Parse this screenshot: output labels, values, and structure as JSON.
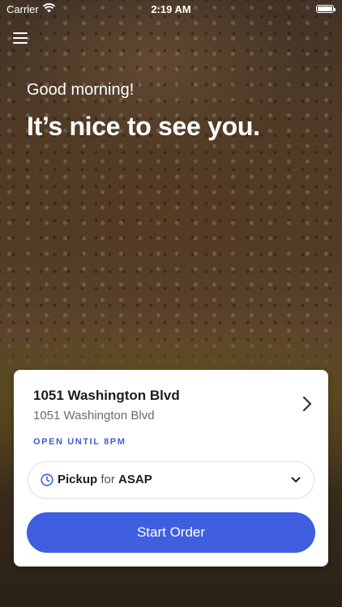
{
  "status_bar": {
    "carrier": "Carrier",
    "time": "2:19 AM",
    "wifi_icon": "wifi-icon",
    "battery_icon": "battery-icon"
  },
  "header": {
    "menu_icon": "hamburger-menu-icon",
    "greeting": "Good morning!",
    "headline": "It’s nice to see you."
  },
  "location_card": {
    "name": "1051 Washington Blvd",
    "address": "1051 Washington Blvd",
    "hours": "OPEN UNTIL 8PM",
    "chevron_icon": "chevron-right-icon",
    "pickup": {
      "icon": "clock-icon",
      "mode": "Pickup",
      "connector": "for",
      "time": "ASAP",
      "dropdown_icon": "chevron-down-icon"
    },
    "start_order_label": "Start Order"
  },
  "colors": {
    "accent": "#3f5fe0",
    "hours_text": "#3d5fcf",
    "card_bg": "#ffffff"
  }
}
